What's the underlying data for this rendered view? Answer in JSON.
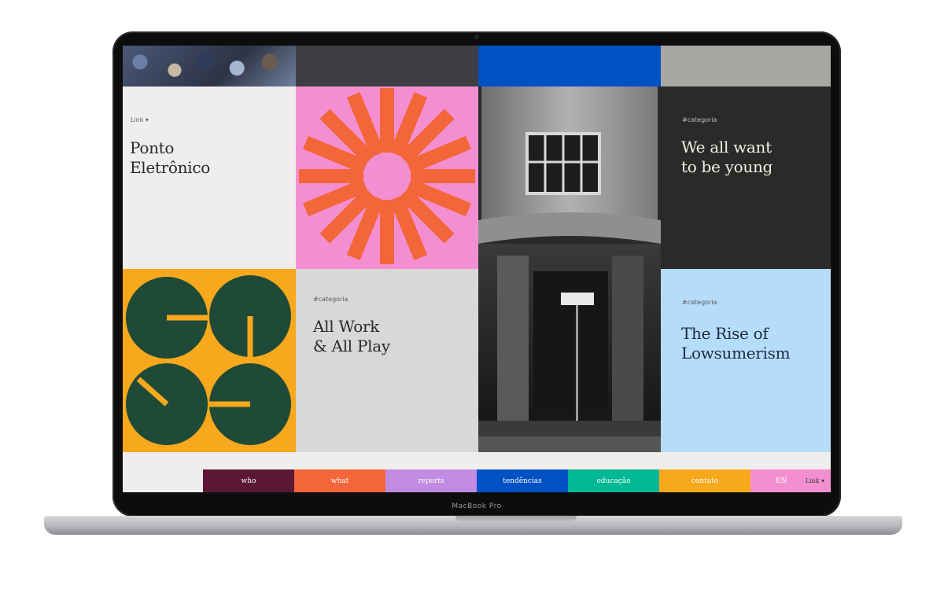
{
  "device": {
    "bezel_label": "MacBook Pro"
  },
  "tiles": {
    "ponto": {
      "label": "Link ▾",
      "title": "Ponto\nEletrônico",
      "bg": "#efeeec"
    },
    "young": {
      "label": "#categoria",
      "title": "We all want\nto be young",
      "bg": "#2b2a29"
    },
    "allwork": {
      "label": "#categoria",
      "title": "All Work\n& All Play",
      "bg": "#d9d8d6"
    },
    "rise": {
      "label": "#categoria",
      "title": "The Rise of\nLowsumerism",
      "bg": "#b6dcfb"
    },
    "sunburst": {
      "icon": "sunburst-icon",
      "bg": "#f38fd0",
      "ray_color": "#f3663a"
    },
    "circles": {
      "icon": "circle-glyphs-icon",
      "bg": "#f7a81c",
      "circle_color": "#1f4a37"
    }
  },
  "nav": {
    "items": [
      {
        "label": "who",
        "color": "#5b1733"
      },
      {
        "label": "what",
        "color": "#f3663a"
      },
      {
        "label": "reports",
        "color": "#c08be0"
      },
      {
        "label": "tendências",
        "color": "#0051c4"
      },
      {
        "label": "educação",
        "color": "#00b894"
      },
      {
        "label": "contato",
        "color": "#f7a81c"
      },
      {
        "label": "EN",
        "color": "#f38fd0"
      }
    ],
    "lang_label": "Link ▾"
  }
}
